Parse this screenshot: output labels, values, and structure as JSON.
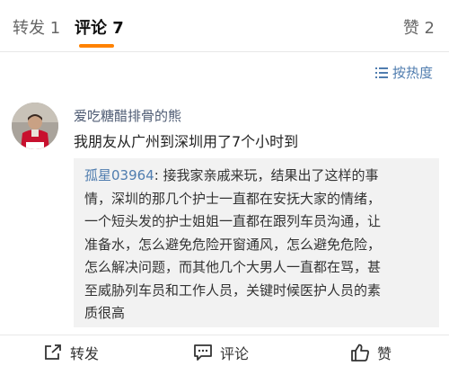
{
  "tabs": {
    "repost": "转发 1",
    "comment": "评论 7",
    "like": "赞 2"
  },
  "sort": {
    "label": "按热度",
    "icon": "sort-icon"
  },
  "comment": {
    "username": "爱吃糖醋排骨的熊",
    "text": "我朋友从广州到深圳用了7个小时到",
    "reply": {
      "author": "孤星03964",
      "line1": ": 接我家亲戚来玩，结果出了这样的事",
      "line2": "情，深圳的那几个护士一直都在安抚大家的情绪，",
      "line3": "一个短头发的护士姐姐一直都在跟列车员沟通，让",
      "line4": "准备水，怎么避免危险开窗通风，怎么避免危险，",
      "line5": "怎么解决问题，而其他几个大男人一直都在骂，甚",
      "line6": "至威胁列车员和工作人员，关键时候医护人员的素",
      "line7": "质很高"
    }
  },
  "actions": {
    "repost": "转发",
    "comment": "评论",
    "like": "赞"
  },
  "colors": {
    "accent": "#ff8200",
    "link": "#507daf",
    "username": "#4f5c74",
    "reply_bg": "#f2f2f2"
  }
}
